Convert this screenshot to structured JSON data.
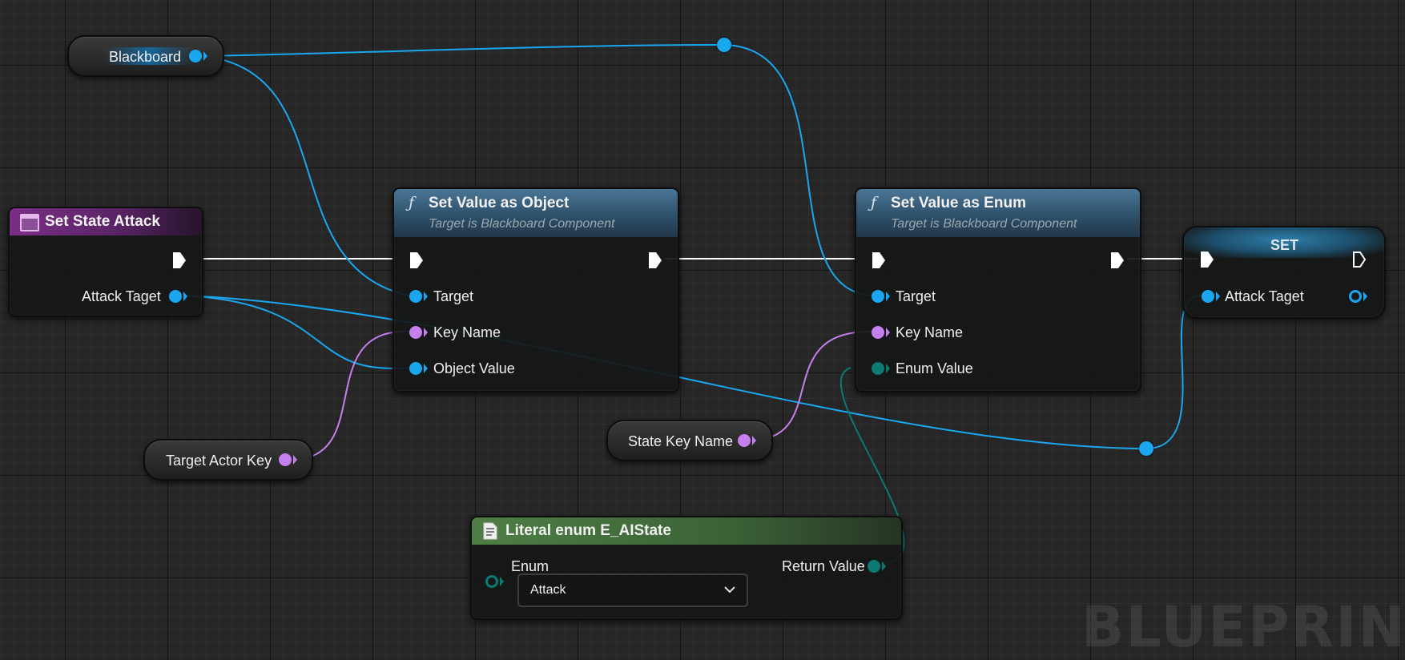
{
  "nodes": {
    "blackboard": {
      "label": "Blackboard"
    },
    "set_state_attack": {
      "title": "Set State Attack",
      "pin_attack_taget": "Attack Taget"
    },
    "set_value_object": {
      "title": "Set Value as Object",
      "subtitle": "Target is Blackboard Component",
      "pin_target": "Target",
      "pin_key_name": "Key Name",
      "pin_object_value": "Object Value"
    },
    "set_value_enum": {
      "title": "Set Value as Enum",
      "subtitle": "Target is Blackboard Component",
      "pin_target": "Target",
      "pin_key_name": "Key Name",
      "pin_enum_value": "Enum Value"
    },
    "set": {
      "title": "SET",
      "pin_attack_taget": "Attack Taget"
    },
    "target_actor_key": {
      "label": "Target Actor Key"
    },
    "state_key_name": {
      "label": "State Key Name"
    },
    "literal_enum": {
      "title": "Literal enum E_AIState",
      "pin_enum": "Enum",
      "pin_return_value": "Return Value",
      "selected_value": "Attack"
    }
  },
  "watermark": "BLUEPRINT",
  "colors": {
    "object_pin": "#1aa7ef",
    "name_pin": "#c580ee",
    "enum_pin": "#0a7a72",
    "exec_wire": "#ffffff",
    "function_header": "#3f6b8c",
    "event_header": "#7a2f86",
    "literal_header": "#4e7e45"
  },
  "icons": [
    "function-icon",
    "event-icon",
    "document-icon",
    "exec-pin-icon",
    "chevron-down-icon"
  ]
}
